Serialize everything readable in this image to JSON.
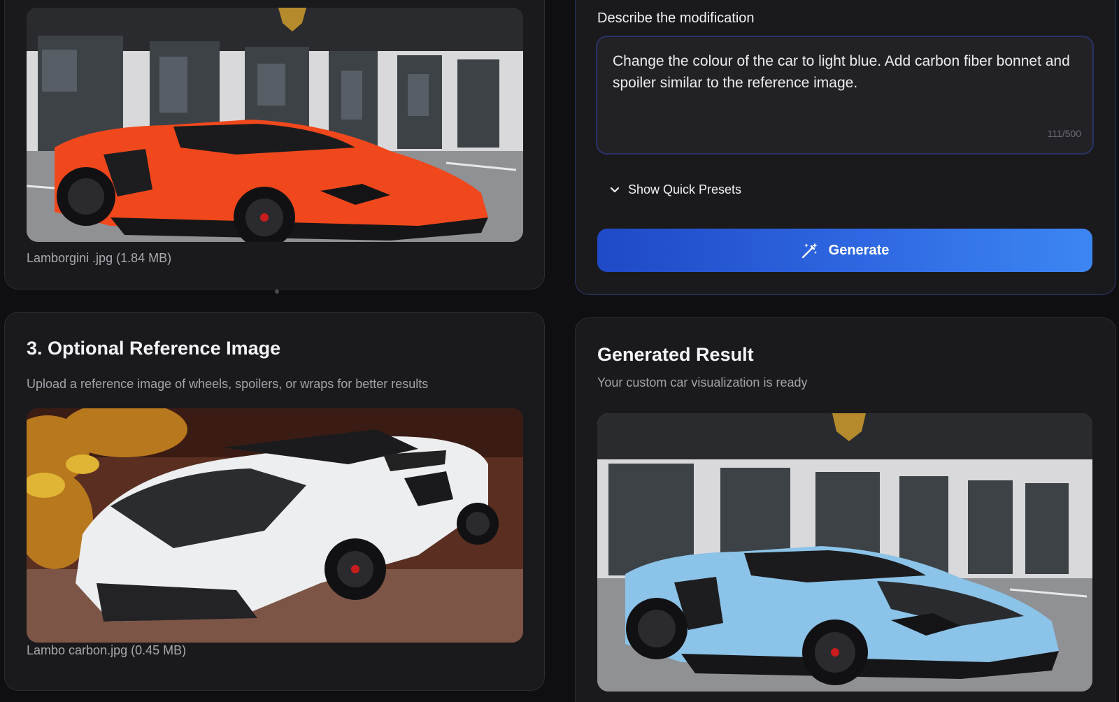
{
  "upload": {
    "file_caption": "Lamborgini .jpg (1.84 MB)",
    "photo_alt": "orange Lamborghini roadster in front of showroom"
  },
  "describe": {
    "label": "Describe the modification",
    "text": "Change the colour of the car to light blue. Add carbon fiber bonnet and spoiler similar to the reference image.",
    "counter": "111/500",
    "presets_label": "Show Quick Presets",
    "presets_icon": "chevron-down-icon",
    "generate_label": "Generate",
    "generate_icon": "magic-wand-icon",
    "accent_gradient": [
      "#1f49c7",
      "#3c86f3"
    ]
  },
  "reference": {
    "title": "3. Optional Reference Image",
    "subtitle": "Upload a reference image of wheels, spoilers, or wraps for better results",
    "file_caption": "Lambo carbon.jpg (0.45 MB)",
    "photo_alt": "white Lamborghini with carbon bonnet"
  },
  "result": {
    "title": "Generated Result",
    "subtitle": "Your custom car visualization is ready",
    "photo_alt": "light blue Lamborghini roadster with carbon bonnet"
  },
  "colors": {
    "background": "#0f0f11",
    "card": "#1a1a1d",
    "orange_car": "#f0481c",
    "blue_car": "#8cc3e8",
    "white_car": "#eceef0"
  }
}
